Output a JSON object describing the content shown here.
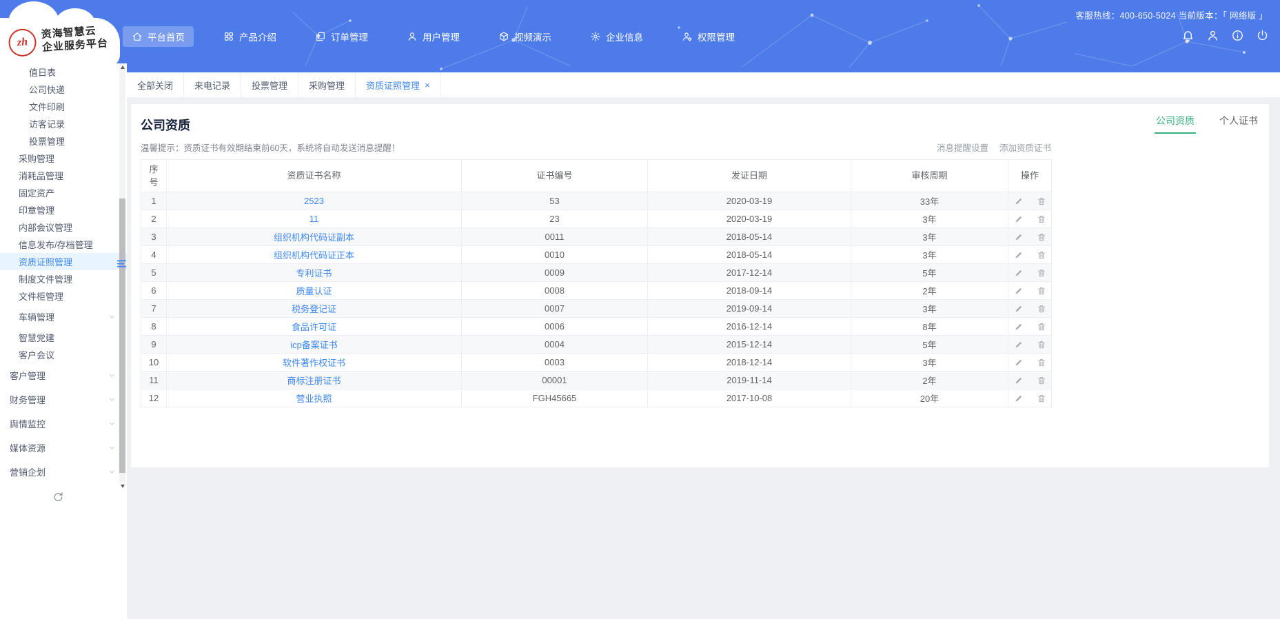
{
  "header": {
    "hotline": "客服热线：400-650-5024 当前版本：「 网络版 」",
    "logo": {
      "monogram": "zh",
      "line1": "资海智慧云",
      "line2": "企业服务平台"
    },
    "nav": [
      {
        "label": "平台首页",
        "name": "nav-platform-home",
        "icon": "home-icon",
        "active": true
      },
      {
        "label": "产品介绍",
        "name": "nav-product-intro",
        "icon": "grid-icon"
      },
      {
        "label": "订单管理",
        "name": "nav-order-management",
        "icon": "orders-icon"
      },
      {
        "label": "用户管理",
        "name": "nav-user-management",
        "icon": "user-icon"
      },
      {
        "label": "视频演示",
        "name": "nav-video-demo",
        "icon": "video-icon"
      },
      {
        "label": "企业信息",
        "name": "nav-company-info",
        "icon": "gear-icon"
      },
      {
        "label": "权限管理",
        "name": "nav-permission-management",
        "icon": "user-gear-icon"
      }
    ],
    "action_icons": [
      "bell-icon",
      "user-icon",
      "info-icon",
      "power-icon"
    ]
  },
  "sidebar": {
    "items": [
      {
        "label": "值日表",
        "level": 2
      },
      {
        "label": "公司快递",
        "level": 2
      },
      {
        "label": "文件印刷",
        "level": 2
      },
      {
        "label": "访客记录",
        "level": 2
      },
      {
        "label": "投票管理",
        "level": 2
      },
      {
        "label": "采购管理",
        "level": 1
      },
      {
        "label": "消耗品管理",
        "level": 1
      },
      {
        "label": "固定资产",
        "level": 1
      },
      {
        "label": "印章管理",
        "level": 1
      },
      {
        "label": "内部会议管理",
        "level": 1
      },
      {
        "label": "信息发布/存档管理",
        "level": 1
      },
      {
        "label": "资质证照管理",
        "level": 1,
        "active": true
      },
      {
        "label": "制度文件管理",
        "level": 1
      },
      {
        "label": "文件柜管理",
        "level": 1
      },
      {
        "label": "车辆管理",
        "level": 1,
        "chevron": true
      },
      {
        "label": "智慧党建",
        "level": 1
      },
      {
        "label": "客户会议",
        "level": 1
      },
      {
        "label": "客户管理",
        "level": 0,
        "chevron": true
      },
      {
        "label": "财务管理",
        "level": 0,
        "chevron": true
      },
      {
        "label": "舆情监控",
        "level": 0,
        "chevron": true
      },
      {
        "label": "媒体资源",
        "level": 0,
        "chevron": true
      },
      {
        "label": "营销企划",
        "level": 0,
        "chevron": true
      }
    ],
    "misc_icons": {
      "refresh": "refresh-icon",
      "collapse": "sidebar-collapse-icon",
      "scroll_up": "scroll-up-icon",
      "scroll_down": "scroll-down-icon"
    }
  },
  "tabbar": {
    "tabs": [
      {
        "label": "全部关闭"
      },
      {
        "label": "来电记录"
      },
      {
        "label": "投票管理"
      },
      {
        "label": "采购管理"
      },
      {
        "label": "资质证照管理",
        "active": true,
        "closable": true
      }
    ]
  },
  "page": {
    "title": "公司资质",
    "view_tabs": [
      {
        "label": "公司资质",
        "active": true
      },
      {
        "label": "个人证书"
      }
    ],
    "notice": "温馨提示：资质证书有效期结束前60天，系统将自动发送消息提醒！",
    "actions": [
      {
        "label": "消息提醒设置"
      },
      {
        "label": "添加资质证书"
      }
    ],
    "table": {
      "columns": [
        "序号",
        "资质证书名称",
        "证书编号",
        "发证日期",
        "审核周期",
        "操作"
      ],
      "row_action_icons": [
        "edit-icon",
        "delete-icon"
      ],
      "rows": [
        {
          "no": "1",
          "name": "2523",
          "code": "53",
          "date": "2020-03-19",
          "period": "33年"
        },
        {
          "no": "2",
          "name": "11",
          "code": "23",
          "date": "2020-03-19",
          "period": "3年"
        },
        {
          "no": "3",
          "name": "组织机构代码证副本",
          "code": "0011",
          "date": "2018-05-14",
          "period": "3年"
        },
        {
          "no": "4",
          "name": "组织机构代码证正本",
          "code": "0010",
          "date": "2018-05-14",
          "period": "3年"
        },
        {
          "no": "5",
          "name": "专利证书",
          "code": "0009",
          "date": "2017-12-14",
          "period": "5年"
        },
        {
          "no": "6",
          "name": "质量认证",
          "code": "0008",
          "date": "2018-09-14",
          "period": "2年"
        },
        {
          "no": "7",
          "name": "税务登记证",
          "code": "0007",
          "date": "2019-09-14",
          "period": "3年"
        },
        {
          "no": "8",
          "name": "食品许可证",
          "code": "0006",
          "date": "2016-12-14",
          "period": "8年"
        },
        {
          "no": "9",
          "name": "icp备案证书",
          "code": "0004",
          "date": "2015-12-14",
          "period": "5年"
        },
        {
          "no": "10",
          "name": "软件著作权证书",
          "code": "0003",
          "date": "2018-12-14",
          "period": "3年"
        },
        {
          "no": "11",
          "name": "商标注册证书",
          "code": "00001",
          "date": "2019-11-14",
          "period": "2年"
        },
        {
          "no": "12",
          "name": "营业执照",
          "code": "FGH45665",
          "date": "2017-10-08",
          "period": "20年"
        }
      ]
    }
  },
  "colors": {
    "header_blue": "#4d7be9",
    "link_blue": "#3d87f5",
    "active_green": "#3aaf7e",
    "logo_red": "#c9342b",
    "body_gray": "#eef0f3"
  }
}
